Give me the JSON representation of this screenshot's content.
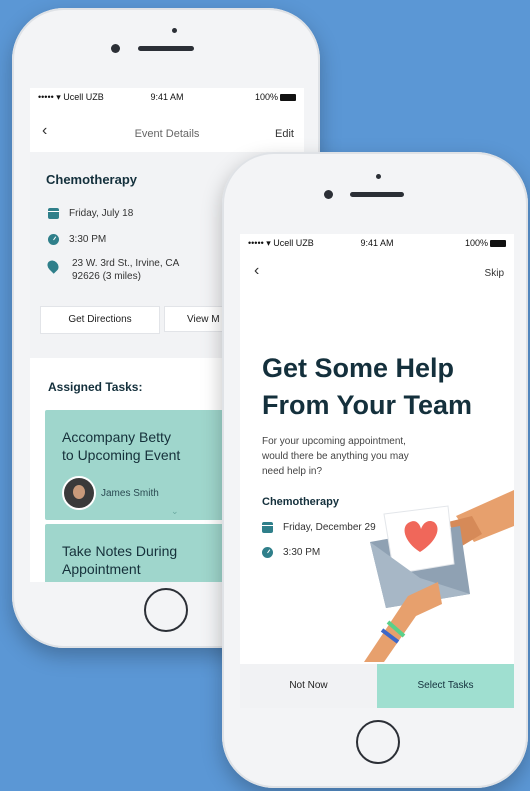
{
  "status": {
    "carrier": "••••• ▾ Ucell UZB",
    "time": "9:41 AM",
    "battery": "100%"
  },
  "phone1": {
    "nav": {
      "title": "Event Details",
      "edit": "Edit"
    },
    "event": {
      "title": "Chemotherapy",
      "date": "Friday, July 18",
      "time": "3:30 PM",
      "address_line1": "23 W. 3rd St., Irvine, CA",
      "address_line2": "92626 (3 miles)"
    },
    "buttons": {
      "directions": "Get Directions",
      "view_map": "View M"
    },
    "tasks_heading": "Assigned Tasks:",
    "tasks": [
      {
        "title_line1": "Accompany Betty",
        "title_line2": "to Upcoming Event",
        "assignee": "James Smith"
      },
      {
        "title_line1": "Take Notes During",
        "title_line2": "Appointment"
      }
    ]
  },
  "phone2": {
    "nav": {
      "skip": "Skip"
    },
    "heading_line1": "Get Some Help",
    "heading_line2": "From Your Team",
    "body_line1": "For your upcoming appointment,",
    "body_line2": "would there be anything you may",
    "body_line3": "need help in?",
    "event": {
      "title": "Chemotherapy",
      "date": "Friday, December 29",
      "time": "3:30 PM"
    },
    "buttons": {
      "not_now": "Not Now",
      "select_tasks": "Select Tasks"
    }
  },
  "colors": {
    "background": "#5b97d5",
    "teal": "#2f7f8a",
    "mint": "#9fd6cc",
    "heart": "#f0675a"
  }
}
